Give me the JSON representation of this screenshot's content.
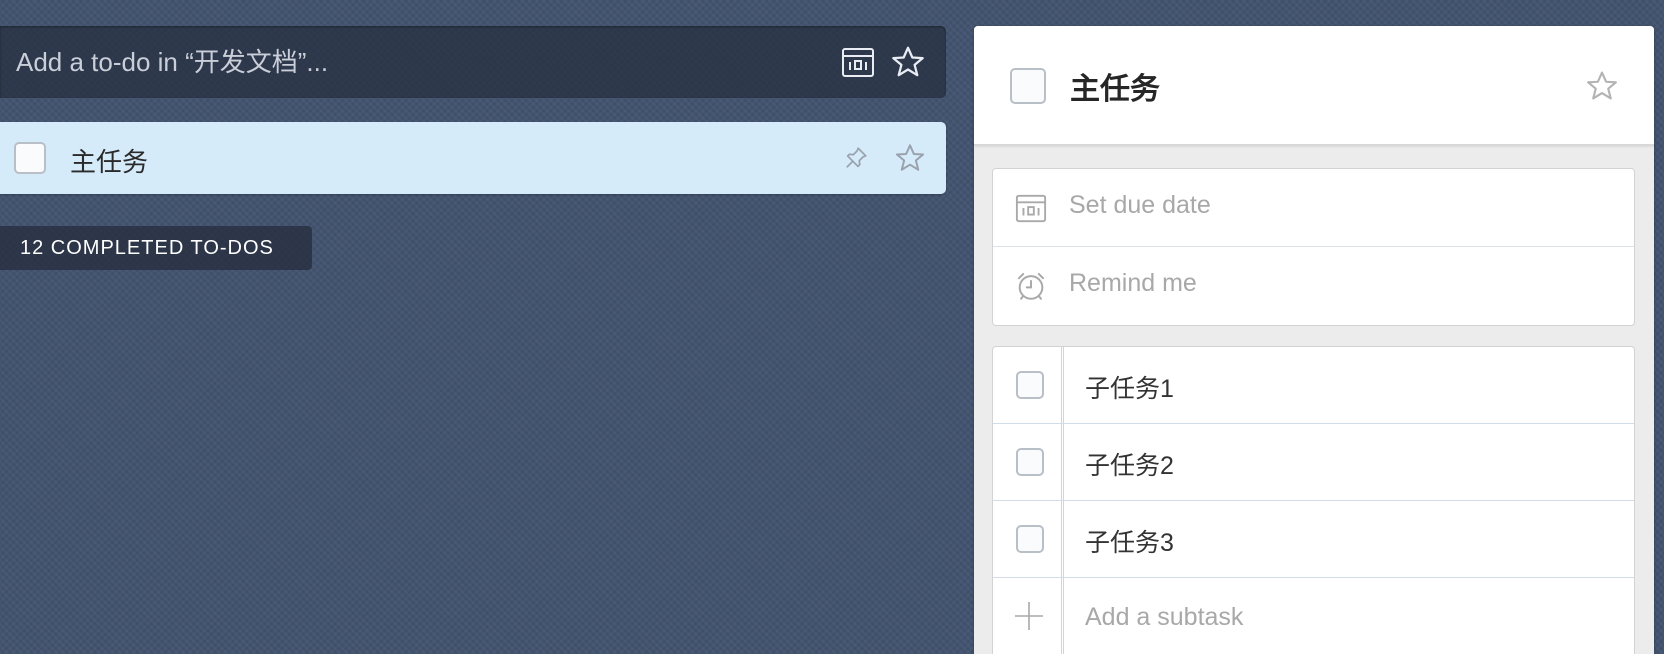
{
  "add_bar": {
    "placeholder": "Add a to-do in “开发文档”...",
    "calendar_icon": "calendar-icon",
    "star_icon": "star-icon"
  },
  "task_list": {
    "tasks": [
      {
        "title": "主任务",
        "selected": true,
        "pin_icon": "pin-icon",
        "star_icon": "star-icon"
      }
    ],
    "completed_label": "12 COMPLETED TO-DOS"
  },
  "detail": {
    "title": "主任务",
    "star_icon": "star-icon",
    "due_date_label": "Set due date",
    "reminder_label": "Remind me",
    "subtasks": [
      {
        "title": "子任务1"
      },
      {
        "title": "子任务2"
      },
      {
        "title": "子任务3"
      }
    ],
    "add_subtask_placeholder": "Add a subtask"
  },
  "colors": {
    "background": "#435470",
    "selected_row": "#d6ebfa",
    "muted_text": "#a8a8a8",
    "subtask_margin_line": "#f1c7c7"
  }
}
